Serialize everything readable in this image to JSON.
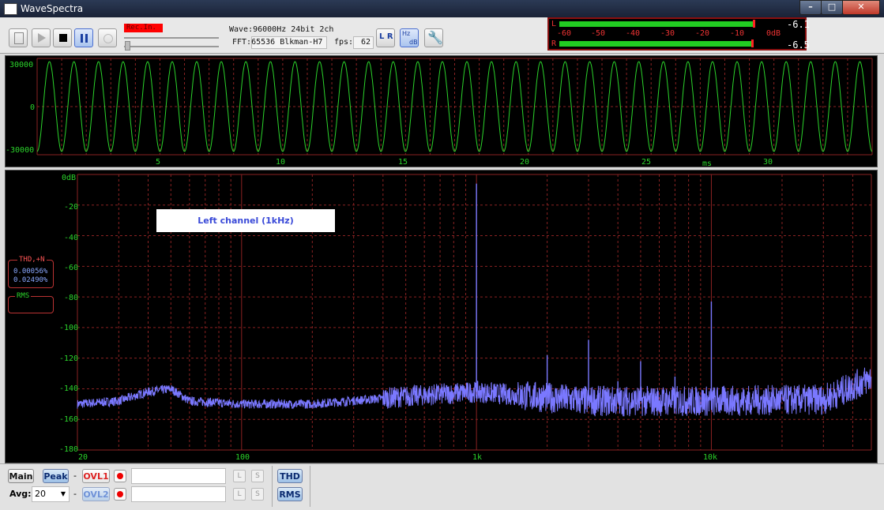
{
  "window": {
    "title": "WaveSpectra"
  },
  "toolbar": {
    "rec_input": "Rec.In.",
    "wave_info": "Wave:96000Hz 24bit 2ch",
    "fft_info": "FFT:65536 Blkman-H7",
    "fps_label": "fps:",
    "fps_value": "62",
    "lr_icon": "L R",
    "hz_db_top": "Hz",
    "hz_db_bottom": "dB"
  },
  "level_meter": {
    "scale": [
      "-60",
      "-50",
      "-40",
      "-30",
      "-20",
      "-10",
      "0dB"
    ],
    "left": {
      "label": "L",
      "value": "-6.1",
      "level_db": -6.1
    },
    "right": {
      "label": "R",
      "value": "-6.5",
      "level_db": -6.5
    }
  },
  "waveform": {
    "y_ticks": [
      "30000",
      "0",
      "-30000"
    ],
    "x_ticks": [
      "5",
      "10",
      "15",
      "20",
      "25",
      "30"
    ],
    "x_unit": "ms"
  },
  "spectrum": {
    "annotation": "Left channel (1kHz)",
    "y_ticks": [
      "0dB",
      "-20",
      "-40",
      "-60",
      "-80",
      "-100",
      "-120",
      "-140",
      "-160",
      "-180"
    ],
    "x_ticks": [
      "20",
      "100",
      "1k",
      "10k"
    ],
    "thd_label": "THD,+N",
    "thd_value": "0.00056%",
    "thdn_value": "0.02490%",
    "rms_label": "RMS"
  },
  "chart_data": [
    {
      "type": "line",
      "series": [
        {
          "values_description": "",
          "frequency_cycles_per_ms": 1,
          "amplitude": 28000
        }
      ],
      "x_range": [
        0,
        34
      ],
      "ylim": [
        -30000,
        30000
      ],
      "xlabel": "ms",
      "grid": true
    },
    {
      "type": "line",
      "x_scale": "log",
      "xlim": [
        20,
        48000
      ],
      "ylim": [
        -180,
        0
      ],
      "grid": true,
      "peaks": [
        {
          "x": 1000,
          "y": -6
        },
        {
          "x": 2000,
          "y": -118
        },
        {
          "x": 3000,
          "y": -108
        },
        {
          "x": 4000,
          "y": -135
        },
        {
          "x": 5000,
          "y": -122
        },
        {
          "x": 7000,
          "y": -132
        },
        {
          "x": 10000,
          "y": -83
        }
      ],
      "noise_floor": [
        {
          "x": 20,
          "y": -150
        },
        {
          "x": 30,
          "y": -148
        },
        {
          "x": 40,
          "y": -142
        },
        {
          "x": 50,
          "y": -140
        },
        {
          "x": 60,
          "y": -148
        },
        {
          "x": 100,
          "y": -150
        },
        {
          "x": 200,
          "y": -150
        },
        {
          "x": 500,
          "y": -145
        },
        {
          "x": 1000,
          "y": -142
        },
        {
          "x": 3000,
          "y": -148
        },
        {
          "x": 10000,
          "y": -148
        },
        {
          "x": 30000,
          "y": -147
        },
        {
          "x": 48000,
          "y": -133
        }
      ]
    }
  ],
  "bottom": {
    "main": "Main",
    "peak": "Peak",
    "dash1": "-",
    "dash2": "-",
    "ovl1": "OVL1",
    "ovl2": "OVL2",
    "avg_label": "Avg:",
    "avg_value": "20",
    "l": "L",
    "s": "S",
    "thd": "THD",
    "rms": "RMS"
  },
  "colors": {
    "trace_wave": "#2bd42b",
    "trace_spec": "#7a78ff",
    "grid": "#8a2222",
    "meter": "#22cc22"
  }
}
